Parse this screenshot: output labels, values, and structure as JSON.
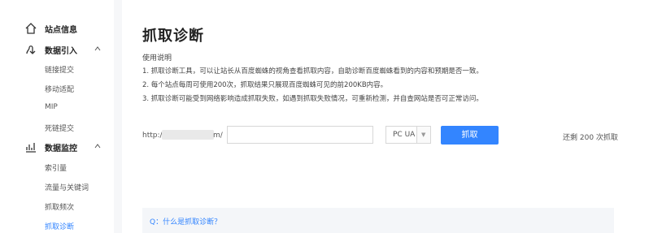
{
  "sidebar": {
    "groups": [
      {
        "label": "站点信息",
        "icon": "home-icon",
        "items": []
      },
      {
        "label": "数据引入",
        "icon": "data-import-icon",
        "chevron": "chevron-up-icon",
        "items": [
          "链接提交",
          "移动适配",
          "MIP",
          "死链提交"
        ]
      },
      {
        "label": "数据监控",
        "icon": "chart-icon",
        "chevron": "chevron-up-icon",
        "items": [
          "索引量",
          "流量与关键词",
          "抓取频次",
          "抓取诊断"
        ]
      }
    ],
    "active_item": "抓取诊断"
  },
  "main": {
    "title": "抓取诊断",
    "usage": {
      "title": "使用说明",
      "lines": [
        "1. 抓取诊断工具，可以让站长从百度蜘蛛的视角查看抓取内容，自助诊断百度蜘蛛看到的内容和预期是否一致。",
        "2. 每个站点每周可使用200次，抓取结果只展现百度蜘蛛可见的前200KB内容。",
        "3. 抓取诊断可能受到网络影响造成抓取失败，如遇到抓取失败情况，可重新检测，并自查网站是否可正常访问。"
      ]
    },
    "form": {
      "url_prefix": "http://w",
      "url_suffix": "m/",
      "url_input_value": "",
      "ua_selected": "PC UA",
      "fetch_label": "抓取",
      "remaining_text": "还剩 200 次抓取"
    },
    "faq": {
      "question": "Q：什么是抓取诊断？"
    }
  },
  "colors": {
    "accent": "#3385ff",
    "page_bg": "#f6f7f9"
  }
}
